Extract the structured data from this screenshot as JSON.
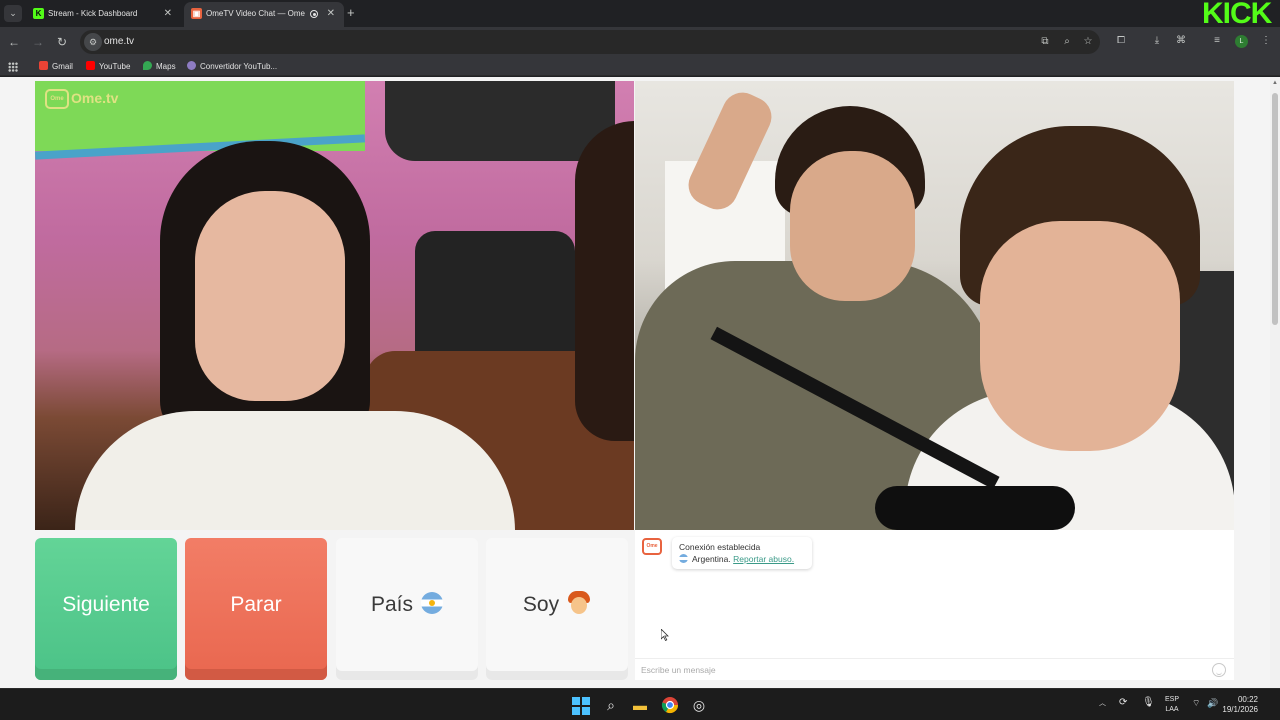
{
  "browser": {
    "tabs": [
      {
        "title": "Stream - Kick Dashboard",
        "favicon": "kick-icon"
      },
      {
        "title": "OmeTV Video Chat — Ome",
        "favicon": "ometv-icon",
        "active": true
      }
    ],
    "url": "ome.tv",
    "bookmarks": [
      {
        "label": "Gmail",
        "icon": "gmail-icon"
      },
      {
        "label": "YouTube",
        "icon": "youtube-icon"
      },
      {
        "label": "Maps",
        "icon": "maps-icon"
      },
      {
        "label": "Convertidor YouTub...",
        "icon": "converter-icon"
      }
    ],
    "profile_initial": "L",
    "overlay_logo": "KICK"
  },
  "page": {
    "logo_text": "Ome.tv",
    "buttons": {
      "next": "Siguiente",
      "stop": "Parar",
      "country": "País",
      "me": "Soy"
    },
    "chat": {
      "system_message": "Conexión establecida",
      "country": "Argentina.",
      "report_link": "Reportar abuso.",
      "input_placeholder": "Escribe un mensaje"
    }
  },
  "taskbar": {
    "language_top": "ESP",
    "language_bottom": "LAA",
    "time": "00:22",
    "date": "19/1/2026"
  },
  "colors": {
    "next_button": "#4bc287",
    "stop_button": "#e9674f",
    "kick_green": "#53fc18",
    "link_teal": "#3a9a88"
  }
}
